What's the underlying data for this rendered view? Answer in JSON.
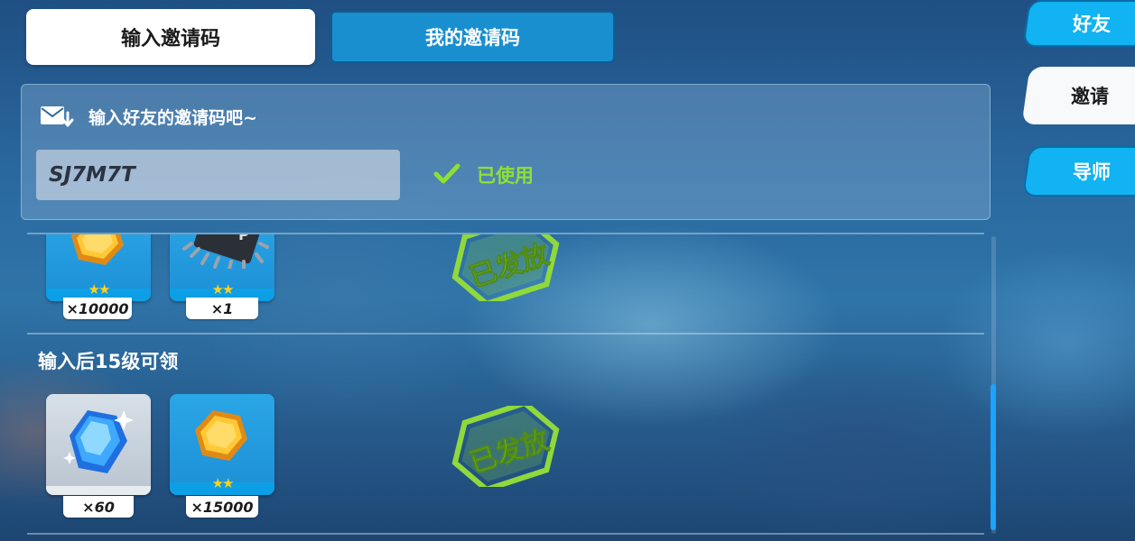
{
  "tabs": {
    "input_code": "输入邀请码",
    "my_code": "我的邀请码"
  },
  "input_panel": {
    "prompt": "输入好友的邀请码吧~",
    "code_value": "SJ7M7T",
    "status": "已使用",
    "icons": {
      "mail": "mail-download-icon",
      "status": "check-icon"
    }
  },
  "reward_rows": [
    {
      "title": "",
      "stamp": "已发放",
      "items": [
        {
          "icon": "gold-coin-icon",
          "stars": "★★",
          "qty": "×10000"
        },
        {
          "icon": "chip-icon",
          "stars": "★★",
          "qty": "×1"
        }
      ]
    },
    {
      "title": "输入后15级可领",
      "stamp": "已发放",
      "items": [
        {
          "icon": "blue-crystal-icon",
          "stars": "",
          "qty": "×60"
        },
        {
          "icon": "gold-coin-icon",
          "stars": "★★",
          "qty": "×15000"
        }
      ]
    }
  ],
  "side_nav": [
    {
      "label": "好友",
      "active": false
    },
    {
      "label": "邀请",
      "active": true
    },
    {
      "label": "导师",
      "active": false
    }
  ],
  "colors": {
    "accent_blue": "#11b3f2",
    "status_green": "#8ee033",
    "scroll_thumb": "#1aa3ff"
  }
}
